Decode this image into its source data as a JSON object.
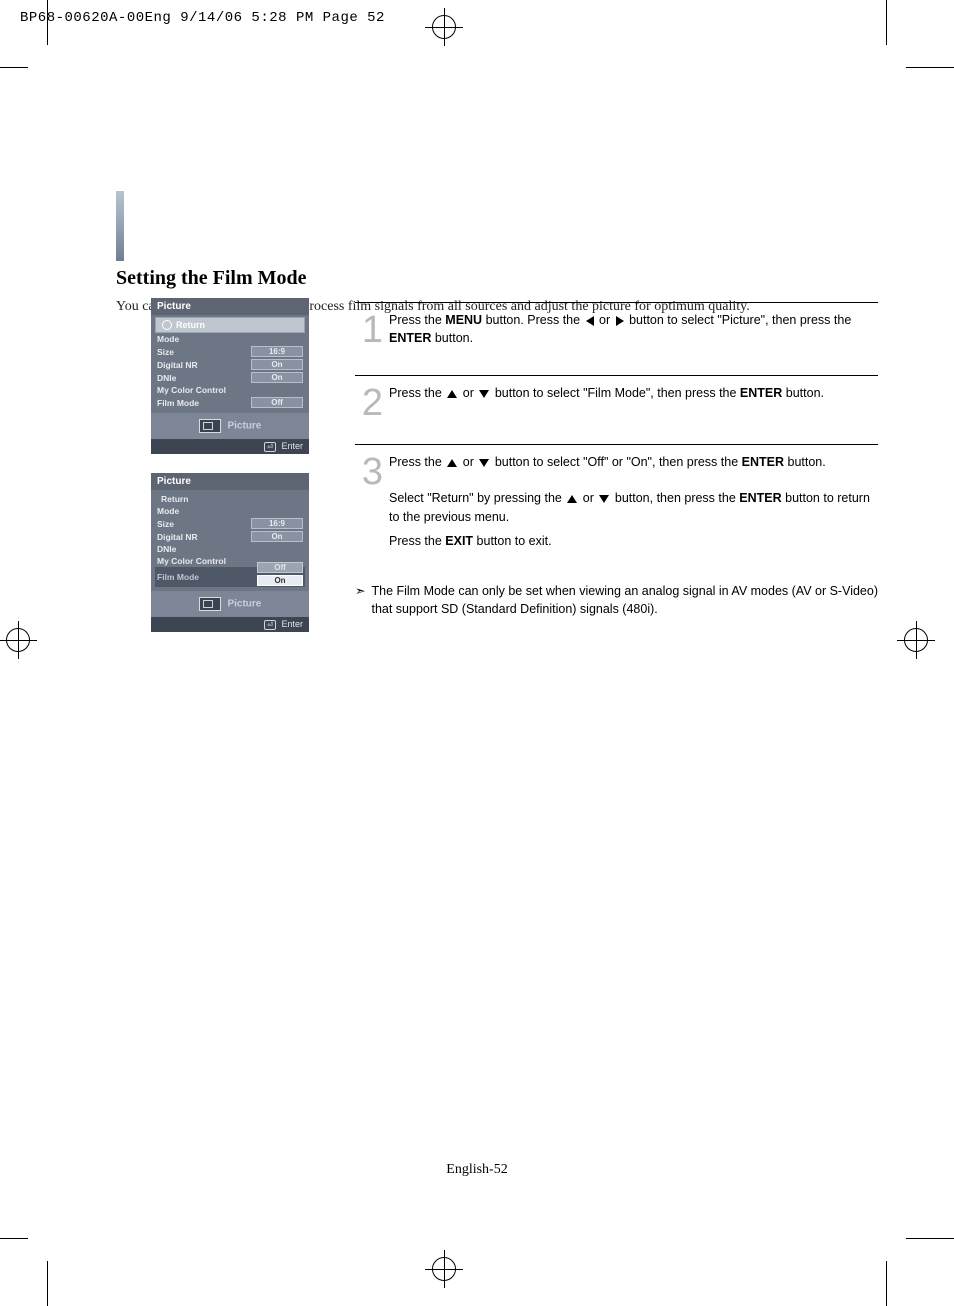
{
  "slug": "BP68-00620A-00Eng  9/14/06  5:28 PM  Page 52",
  "title": "Setting the Film Mode",
  "intro": "You can automatically sense and process film signals from all sources and adjust the picture for optimum quality.",
  "page_number": "English-52",
  "osd": {
    "header": "Picture",
    "return": "Return",
    "footer_enter": "Enter",
    "icon_label": "Picture",
    "items": {
      "mode": "Mode",
      "size": "Size",
      "size_val": "16:9",
      "dnr": "Digital NR",
      "dnr_val": "On",
      "dnie": "DNIe",
      "dnie_val": "On",
      "mcc": "My Color Control",
      "film": "Film Mode",
      "film_val_off": "Off",
      "film_val_on": "On"
    }
  },
  "steps": {
    "s1": {
      "n": "1",
      "a": "Press the ",
      "b": "MENU",
      "c": " button. Press the ",
      "d": " or ",
      "e": " button to select \"Picture\", then press the ",
      "f": "ENTER",
      "g": " button."
    },
    "s2": {
      "n": "2",
      "a": "Press the ",
      "b": " or ",
      "c": " button to select \"Film Mode\", then press the ",
      "d": "ENTER",
      "e": " button."
    },
    "s3": {
      "n": "3",
      "a": "Press the ",
      "b": " or ",
      "c": " button to select \"Off\" or \"On\", then press the ",
      "d": "ENTER",
      "e": " button.",
      "p2a": "Select \"Return\" by pressing the ",
      "p2b": " or ",
      "p2c": " button, then press the ",
      "p2d": "ENTER",
      "p2e": " button to return to the previous menu.",
      "p3a": "Press the ",
      "p3b": "EXIT",
      "p3c": " button to exit."
    }
  },
  "note_marker": "➣",
  "note": "The Film Mode can only be set when viewing an analog signal in AV modes (AV or S-Video) that support SD (Standard Definition) signals (480i)."
}
